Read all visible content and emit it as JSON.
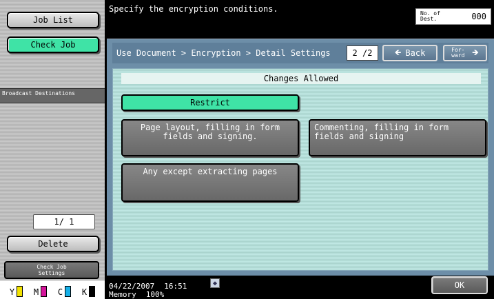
{
  "sidebar": {
    "job_list_label": "Job List",
    "check_job_label": "Check Job",
    "broadcast_header": "Broadcast Destinations",
    "page_indicator": "1/ 1",
    "delete_label": "Delete",
    "check_job_settings_line1": "Check Job",
    "check_job_settings_line2": "Settings",
    "toner": [
      {
        "letter": "Y",
        "color": "#f2e200"
      },
      {
        "letter": "M",
        "color": "#d4149a"
      },
      {
        "letter": "C",
        "color": "#16b0e8"
      },
      {
        "letter": "K",
        "color": "#000000"
      }
    ]
  },
  "header": {
    "message": "Specify the encryption conditions.",
    "dest_label": "No. of Dest.",
    "dest_count": "000"
  },
  "main": {
    "breadcrumb": "Use Document > Encryption > Detail Settings",
    "page": "2 /2",
    "back_label": "Back",
    "forward_label": "For- ward",
    "section_title": "Changes Allowed",
    "options": {
      "restrict": "Restrict",
      "page_layout": "Page layout, filling in form fields and signing.",
      "commenting": "Commenting, filling in form fields and signing",
      "except_extracting": "Any except extracting pages"
    },
    "selected_option": "Restrict",
    "accent_color": "#3fe3a6"
  },
  "status": {
    "date": "04/22/2007",
    "time": "16:51",
    "memory_label": "Memory",
    "memory_value": "100%",
    "ok_label": "OK"
  }
}
